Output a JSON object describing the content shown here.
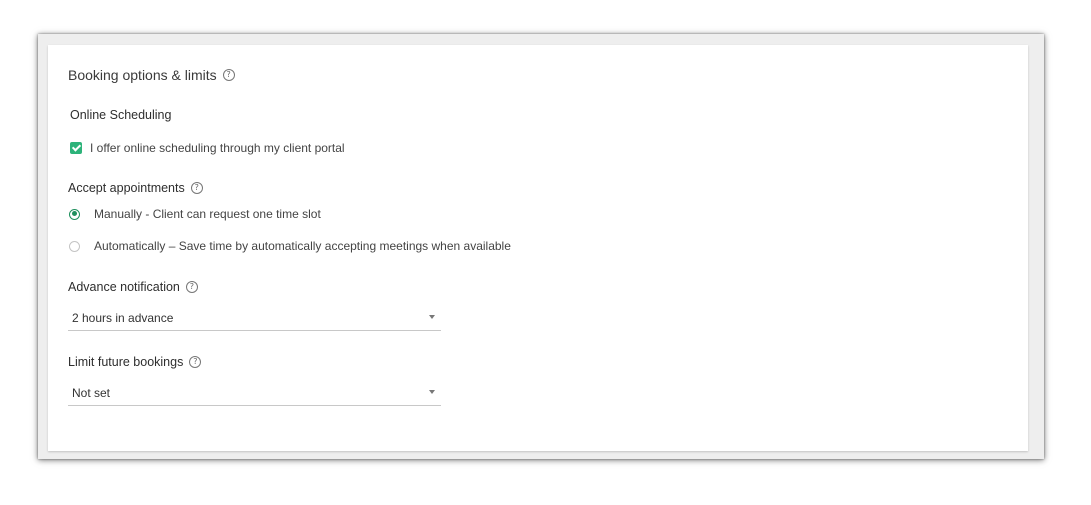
{
  "section": {
    "title": "Booking options & limits",
    "help_icon": "question-circle-icon"
  },
  "online_scheduling": {
    "heading": "Online Scheduling",
    "checkbox_label": "I offer online scheduling through my client portal",
    "checked": true
  },
  "accept_appointments": {
    "heading": "Accept appointments",
    "options": [
      {
        "label": "Manually - Client can request one time slot",
        "selected": true
      },
      {
        "label": "Automatically – Save time by automatically accepting meetings when available",
        "selected": false
      }
    ]
  },
  "advance_notification": {
    "heading": "Advance notification",
    "value": "2 hours in advance"
  },
  "limit_future_bookings": {
    "heading": "Limit future bookings",
    "value": "Not set"
  },
  "colors": {
    "accent": "#2db37a",
    "radio_selected": "#1e8f5c"
  }
}
